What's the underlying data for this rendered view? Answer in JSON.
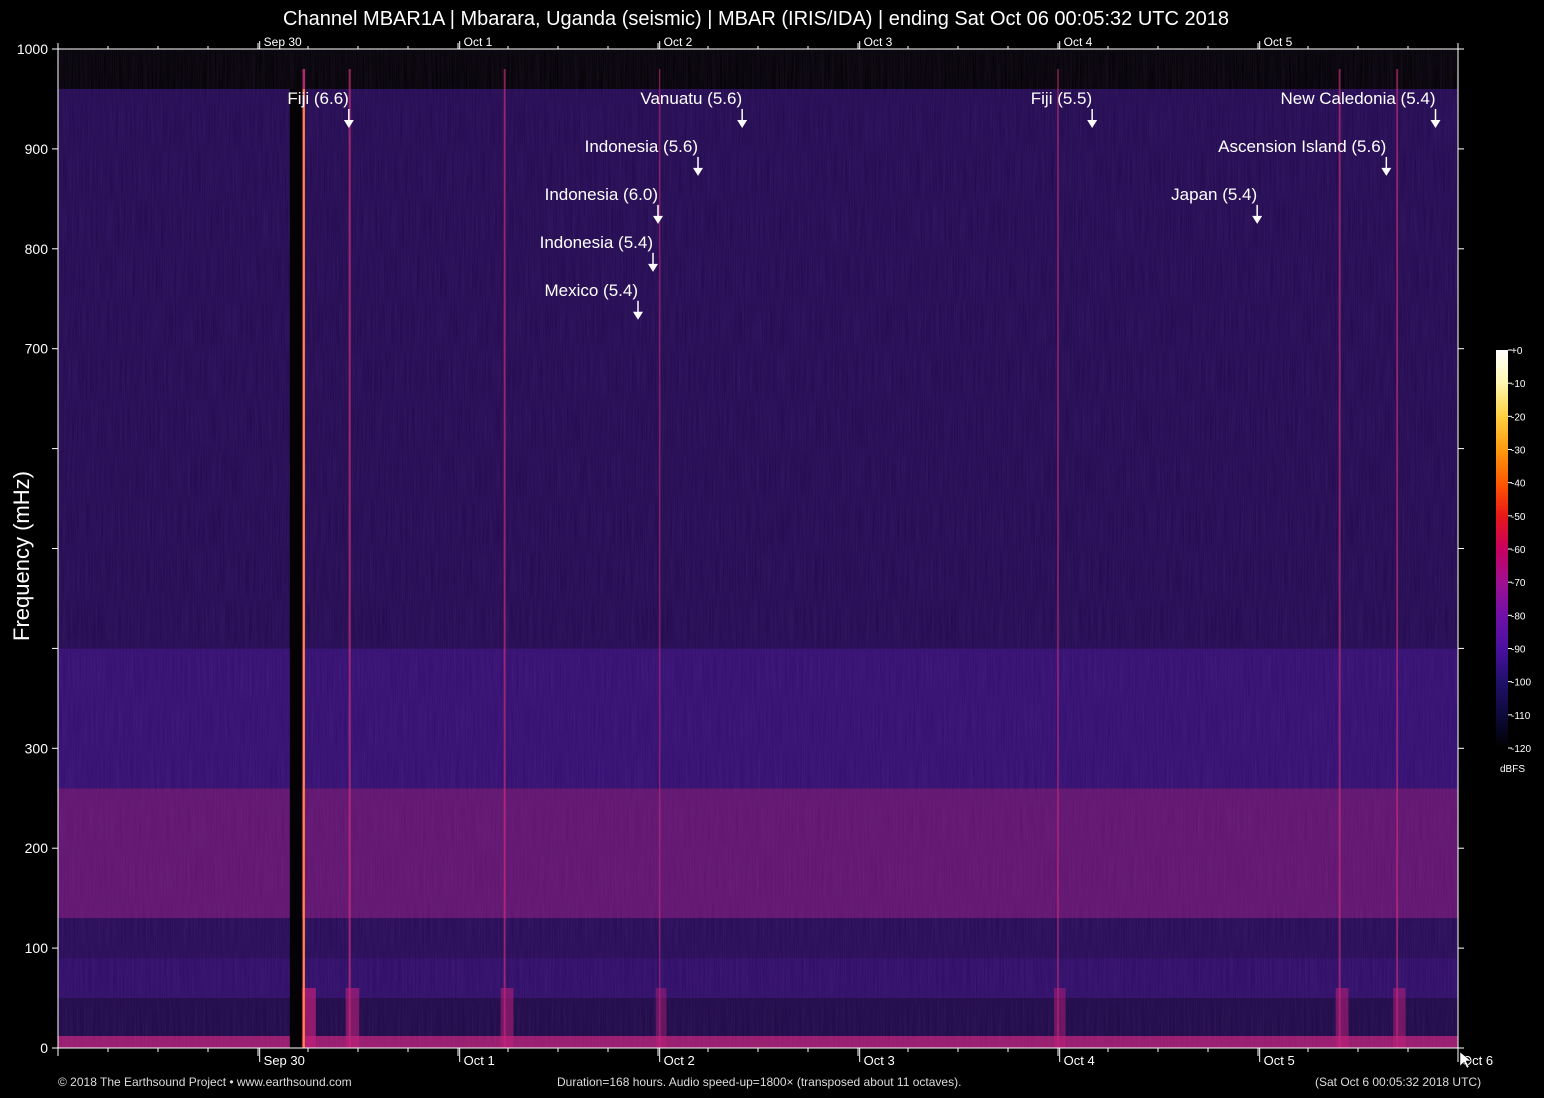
{
  "header": {
    "title": "Channel MBAR1A | Mbarara, Uganda (seismic) | MBAR (IRIS/IDA) | ending Sat Oct 06 00:05:32 UTC 2018"
  },
  "footer": {
    "copyright": "© 2018 The Earthsound Project • www.earthsound.com",
    "duration": "Duration=168 hours. Audio speed-up=1800× (transposed about 11 octaves).",
    "end_time": "(Sat Oct  6 00:05:32 2018 UTC)"
  },
  "colors": {
    "background": "#000000",
    "spectrogram_low": "#0a0620",
    "spectrogram_mid": "#3a1080",
    "spectrogram_high": "#c0207a",
    "text": "#ffffff"
  },
  "chart_data": {
    "type": "heatmap",
    "title": "Channel MBAR1A | Mbarara, Uganda (seismic) | MBAR (IRIS/IDA) | ending Sat Oct 06 00:05:32 UTC 2018",
    "ylabel": "Frequency (mHz)",
    "xlabel": "",
    "x_unit": "hours",
    "xlim": [
      0,
      168
    ],
    "ylim": [
      0,
      1000
    ],
    "y_ticks": [
      0,
      100,
      200,
      300,
      400,
      500,
      600,
      700,
      800,
      900,
      1000
    ],
    "y_tick_labels": [
      "0",
      "100",
      "200",
      "300",
      "",
      "",
      "",
      "700",
      "800",
      "900",
      "1000"
    ],
    "x_ticks": [
      {
        "label": "Sep 30",
        "hour": 24.2
      },
      {
        "label": "Oct  1",
        "hour": 48.2
      },
      {
        "label": "Oct  2",
        "hour": 72.2
      },
      {
        "label": "Oct  3",
        "hour": 96.2
      },
      {
        "label": "Oct  4",
        "hour": 120.2
      },
      {
        "label": "Oct  5",
        "hour": 144.2
      }
    ],
    "x_ticks_bottom": [
      {
        "label": "Sep 30",
        "hour": 24.2
      },
      {
        "label": "Oct  1",
        "hour": 48.2
      },
      {
        "label": "Oct  2",
        "hour": 72.2
      },
      {
        "label": "Oct  3",
        "hour": 96.2
      },
      {
        "label": "Oct  4",
        "hour": 120.2
      },
      {
        "label": "Oct  5",
        "hour": 144.2
      },
      {
        "label": "Oct  6",
        "hour": 168.0
      }
    ],
    "bands": [
      {
        "ymin": 0,
        "ymax": 12,
        "level": 0.95
      },
      {
        "ymin": 12,
        "ymax": 50,
        "level": 0.25
      },
      {
        "ymin": 50,
        "ymax": 90,
        "level": 0.45
      },
      {
        "ymin": 90,
        "ymax": 130,
        "level": 0.35
      },
      {
        "ymin": 130,
        "ymax": 260,
        "level": 0.7
      },
      {
        "ymin": 260,
        "ymax": 400,
        "level": 0.5
      },
      {
        "ymin": 400,
        "ymax": 960,
        "level": 0.3
      }
    ],
    "events": [
      {
        "label": "Fiji (6.6)",
        "hour": 34.9,
        "y": 965
      },
      {
        "label": "Vanuatu (5.6)",
        "hour": 82.1,
        "y": 965
      },
      {
        "label": "Indonesia (5.6)",
        "hour": 76.8,
        "y": 917
      },
      {
        "label": "Indonesia (6.0)",
        "hour": 72.0,
        "y": 869
      },
      {
        "label": "Indonesia (5.4)",
        "hour": 71.4,
        "y": 821
      },
      {
        "label": "Mexico (5.4)",
        "hour": 69.6,
        "y": 773
      },
      {
        "label": "Fiji (5.5)",
        "hour": 124.1,
        "y": 965
      },
      {
        "label": "New Caledonia (5.4)",
        "hour": 165.3,
        "y": 965
      },
      {
        "label": "Ascension Island (5.6)",
        "hour": 159.4,
        "y": 917
      },
      {
        "label": "Japan (5.4)",
        "hour": 143.9,
        "y": 869
      }
    ],
    "event_lines": [
      {
        "hour": 29.5,
        "strength": 1.0
      },
      {
        "hour": 35.0,
        "strength": 0.7
      },
      {
        "hour": 53.6,
        "strength": 0.6
      },
      {
        "hour": 72.2,
        "strength": 0.35
      },
      {
        "hour": 120.0,
        "strength": 0.45
      },
      {
        "hour": 153.8,
        "strength": 0.6
      },
      {
        "hour": 160.7,
        "strength": 0.55
      }
    ],
    "colorbar": {
      "label": "dBFS",
      "ticks": [
        0,
        -10,
        -20,
        -30,
        -40,
        -50,
        -60,
        -70,
        -80,
        -90,
        -100,
        -110,
        -120
      ],
      "tick_labels": [
        "+0",
        "-10",
        "-20",
        "-30",
        "-40",
        "-50",
        "-60",
        "-70",
        "-80",
        "-90",
        "-100",
        "-110",
        "-120"
      ],
      "colors": [
        "#ffffff",
        "#fff7b0",
        "#ffd040",
        "#ff9a10",
        "#ff5a00",
        "#e81818",
        "#c80060",
        "#a01090",
        "#7010a8",
        "#4a10a0",
        "#20106a",
        "#0e0a3a",
        "#000000"
      ]
    }
  }
}
